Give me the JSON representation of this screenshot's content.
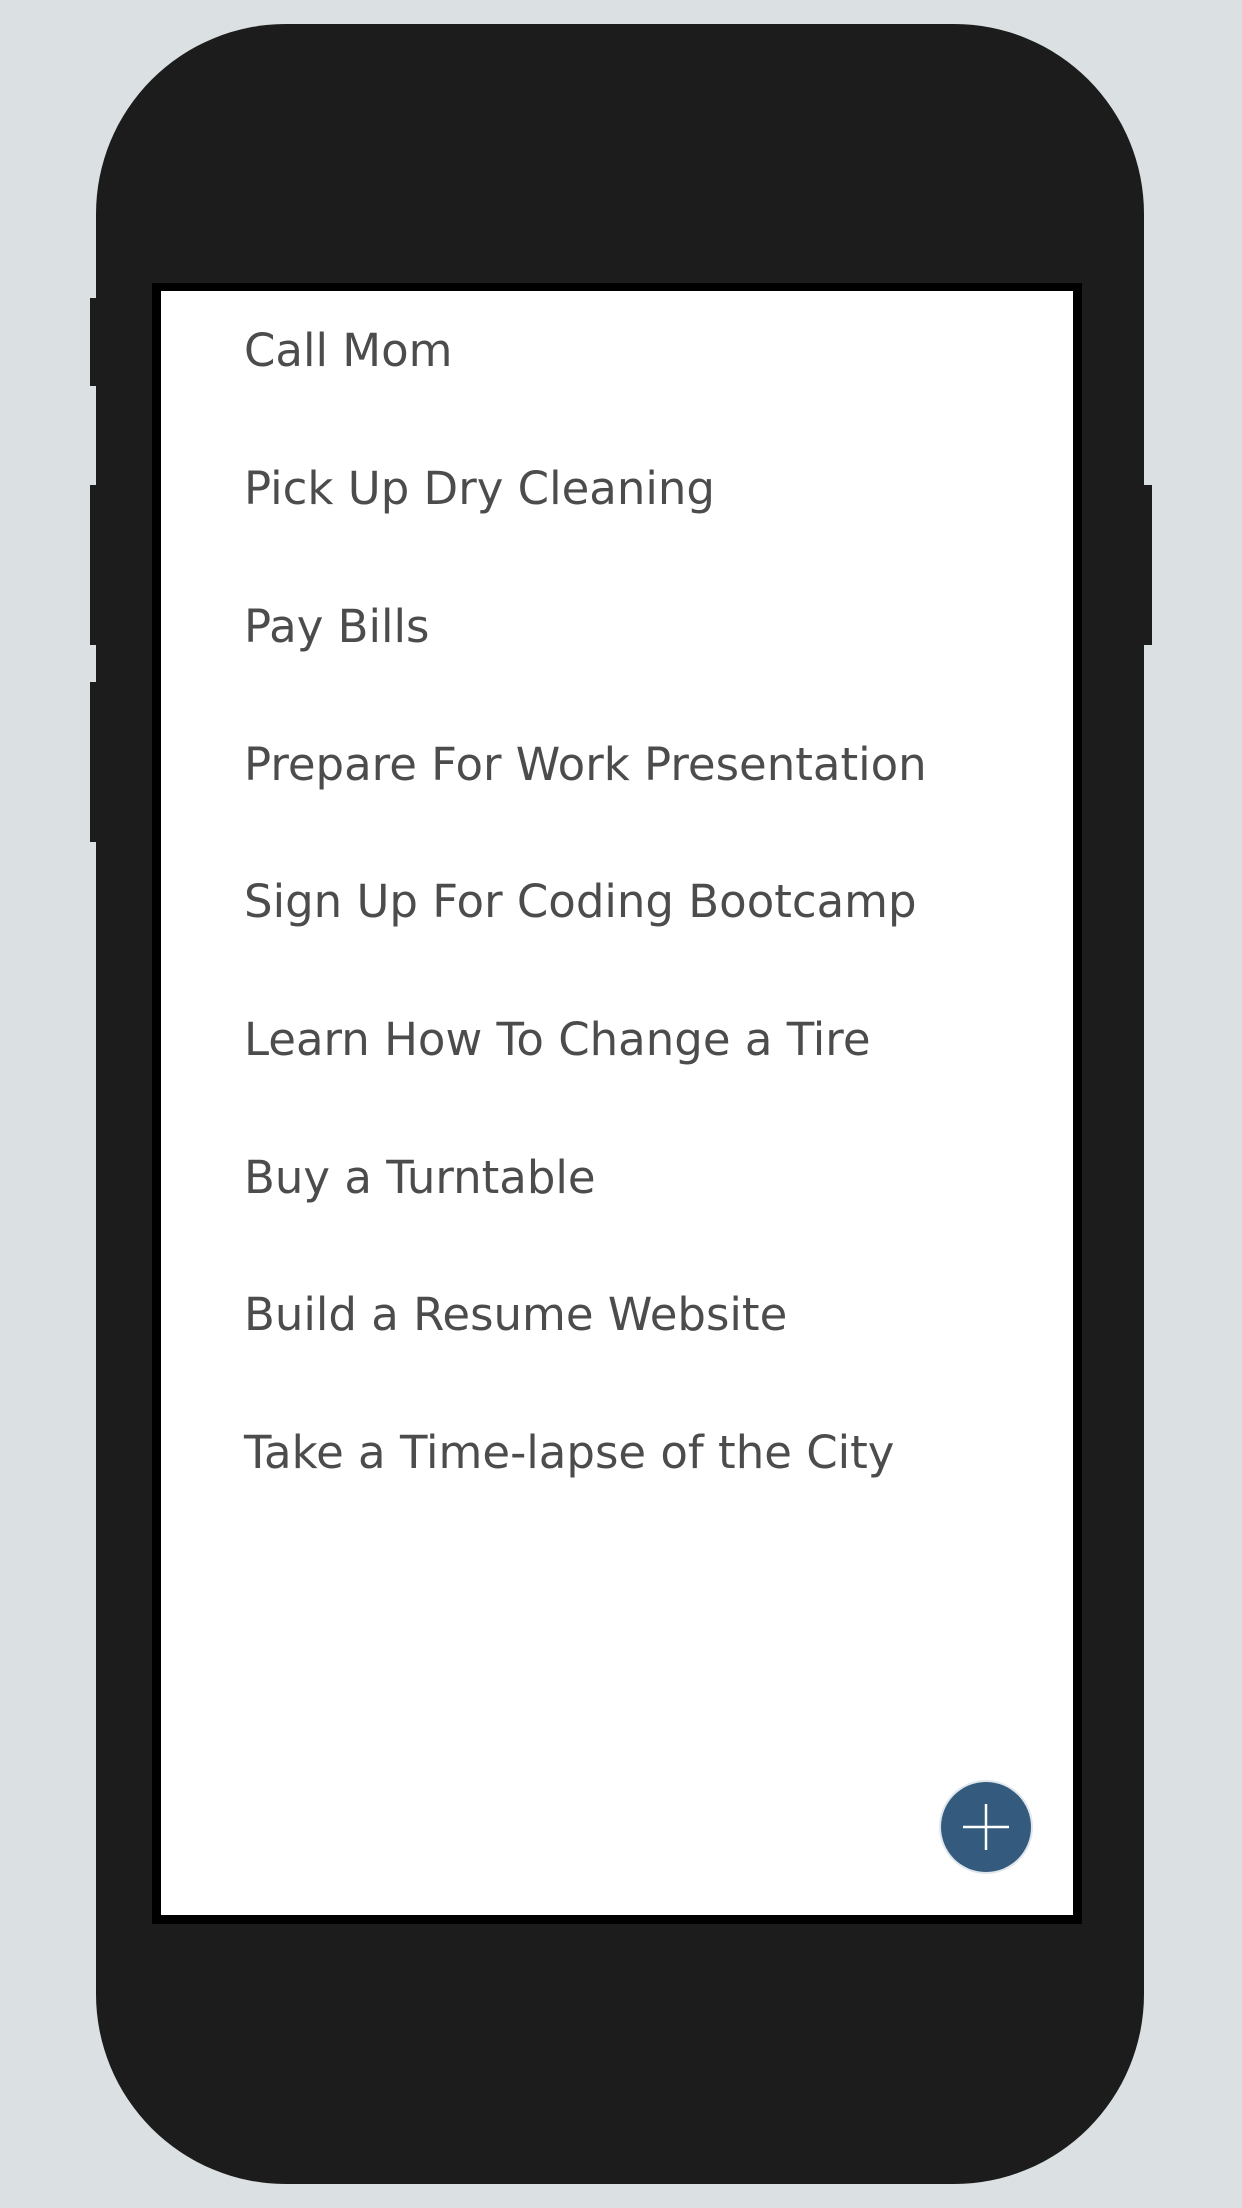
{
  "tasks": [
    "Call Mom",
    "Pick Up Dry Cleaning",
    "Pay Bills",
    "Prepare For Work Presentation",
    "Sign Up For Coding Bootcamp",
    "Learn How To Change a Tire",
    "Buy a Turntable",
    "Build a Resume Website",
    "Take a Time-lapse of the City"
  ],
  "add_button": {
    "icon": "plus-icon"
  },
  "colors": {
    "background": "#dbe0e3",
    "device": "#1c1c1c",
    "task_text": "#4c4c4c",
    "accent": "#345a7e"
  }
}
